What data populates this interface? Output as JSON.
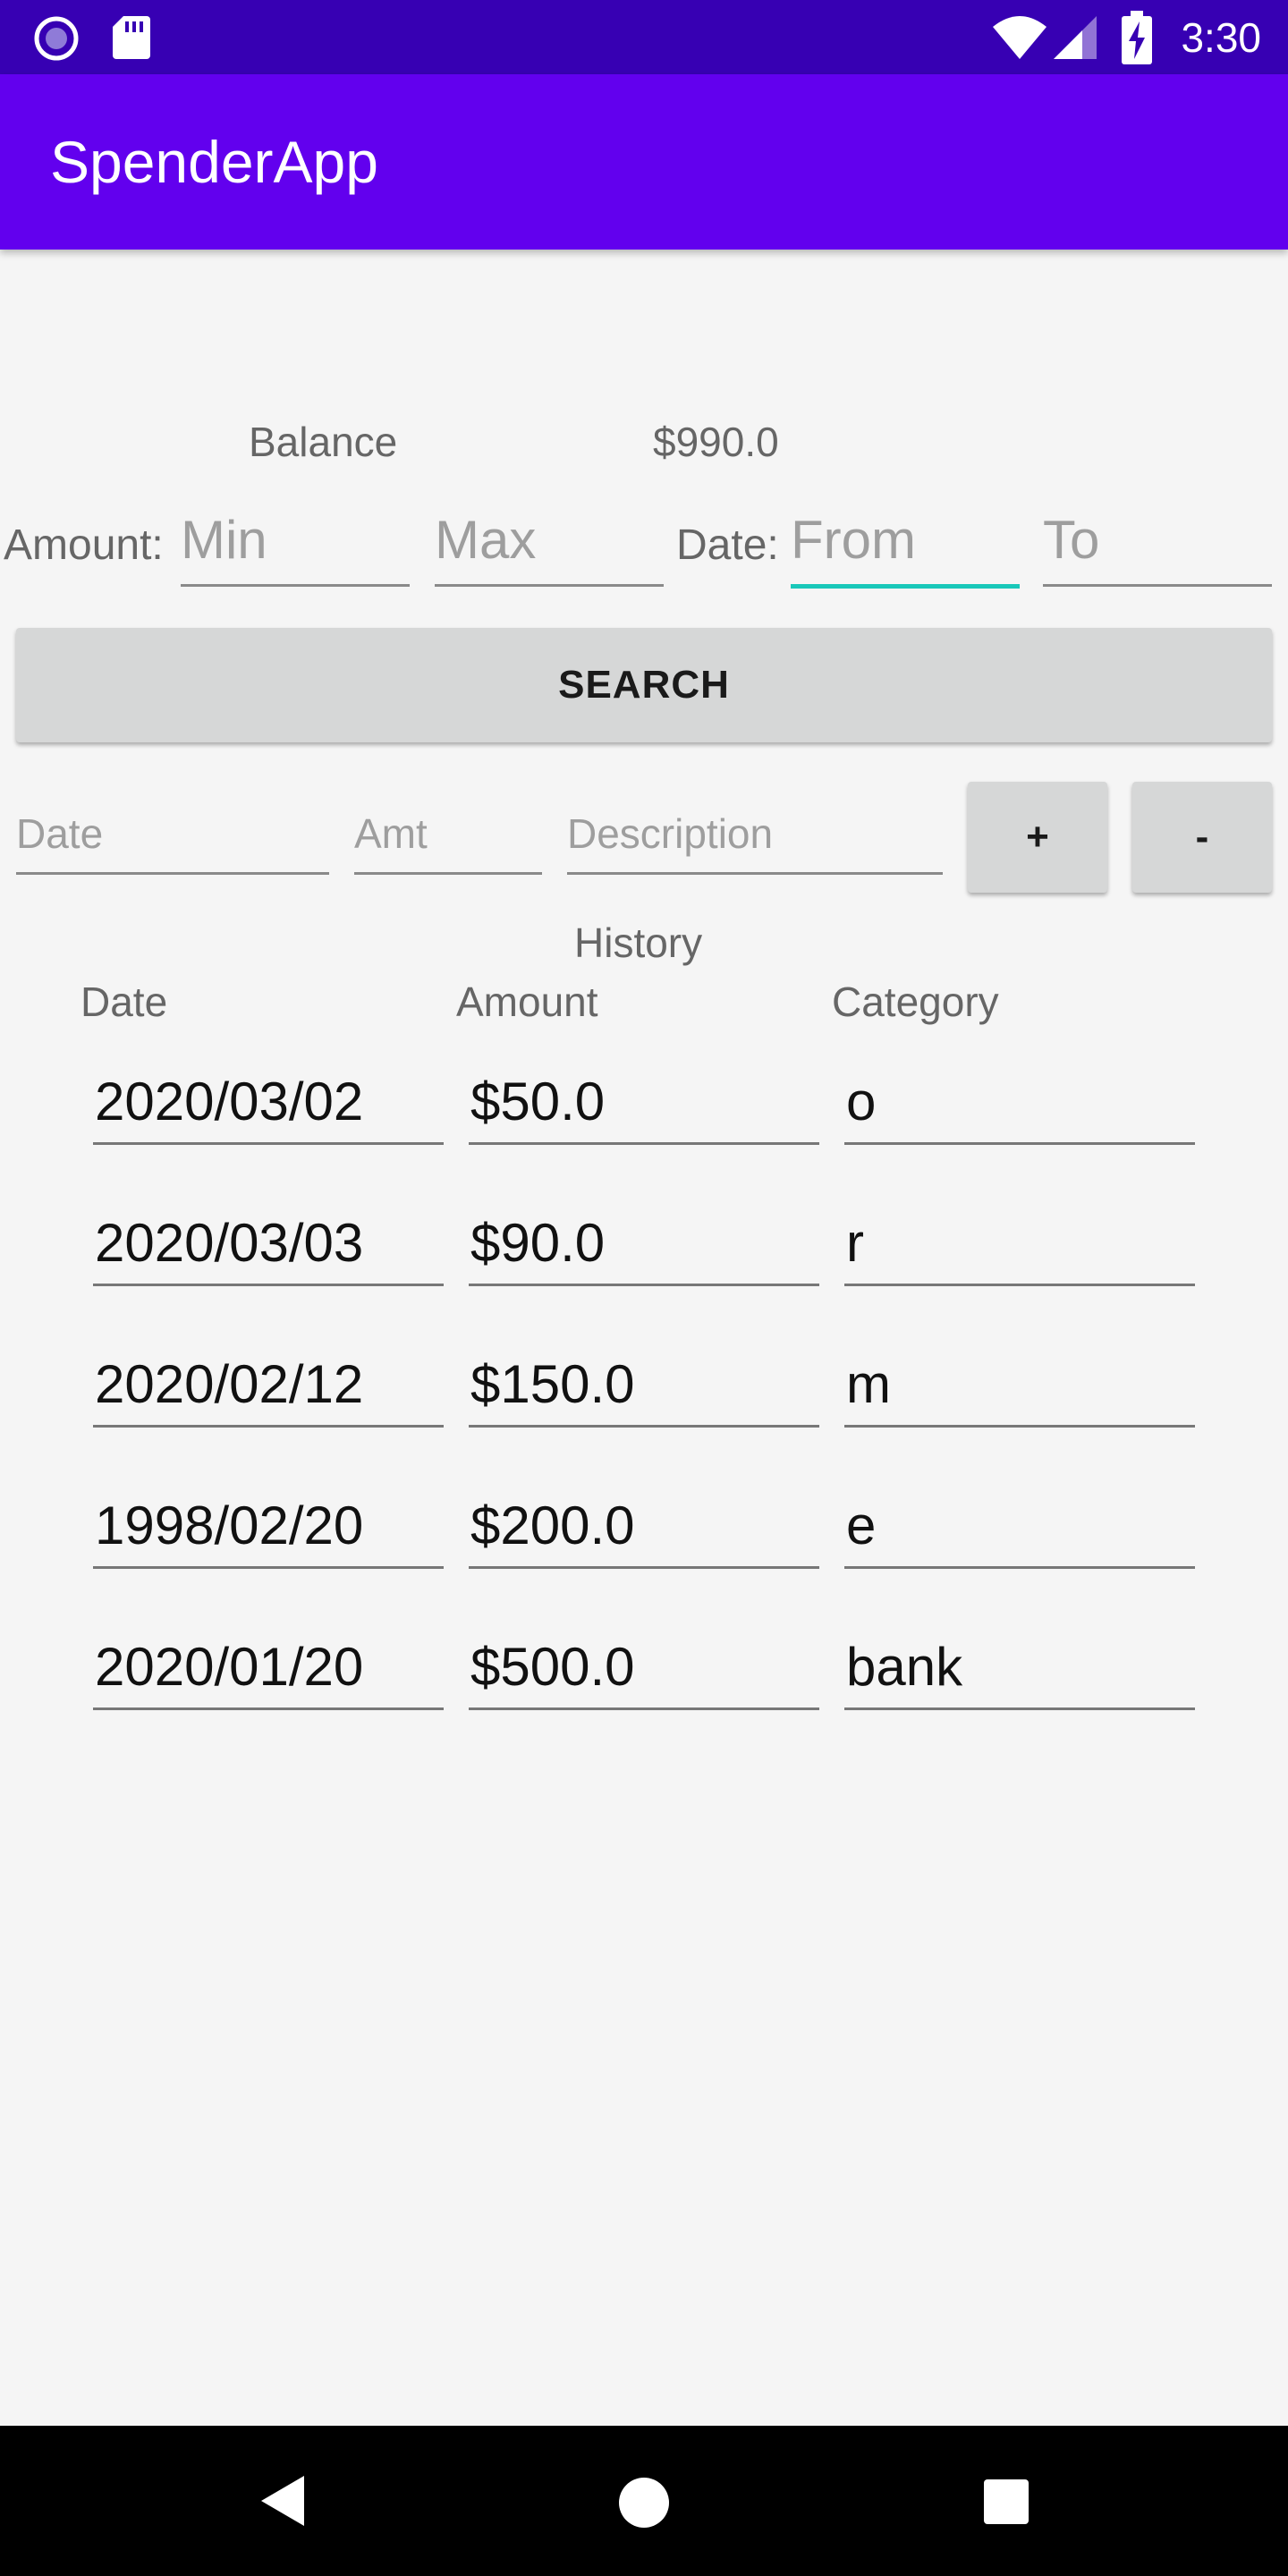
{
  "status_bar": {
    "time": "3:30",
    "icons": [
      "record-icon",
      "sd-card-icon",
      "wifi-icon",
      "signal-icon",
      "battery-charging-icon"
    ]
  },
  "app_bar": {
    "title": "SpenderApp"
  },
  "balance": {
    "label": "Balance",
    "value": "$990.0"
  },
  "filters": {
    "amount_label": "Amount:",
    "min_placeholder": "Min",
    "max_placeholder": "Max",
    "date_label": "Date:",
    "from_placeholder": "From",
    "to_placeholder": "To",
    "search_label": "SEARCH"
  },
  "entry": {
    "date_placeholder": "Date",
    "amt_placeholder": "Amt",
    "description_placeholder": "Description",
    "add_label": "+",
    "subtract_label": "-"
  },
  "history": {
    "title": "History",
    "columns": [
      "Date",
      "Amount",
      "Category"
    ],
    "rows": [
      {
        "date": "2020/03/02",
        "amount": "$50.0",
        "category": "o"
      },
      {
        "date": "2020/03/03",
        "amount": "$90.0",
        "category": "r"
      },
      {
        "date": "2020/02/12",
        "amount": "$150.0",
        "category": "m"
      },
      {
        "date": "1998/02/20",
        "amount": "$200.0",
        "category": "e"
      },
      {
        "date": "2020/01/20",
        "amount": "$500.0",
        "category": "bank"
      }
    ]
  },
  "nav_bar": {
    "icons": [
      "back-icon",
      "home-icon",
      "recents-icon"
    ]
  },
  "colors": {
    "status_bar": "#3700b3",
    "app_bar": "#6200ee",
    "focus_accent": "#19c8b9",
    "button": "#d6d7d7"
  }
}
